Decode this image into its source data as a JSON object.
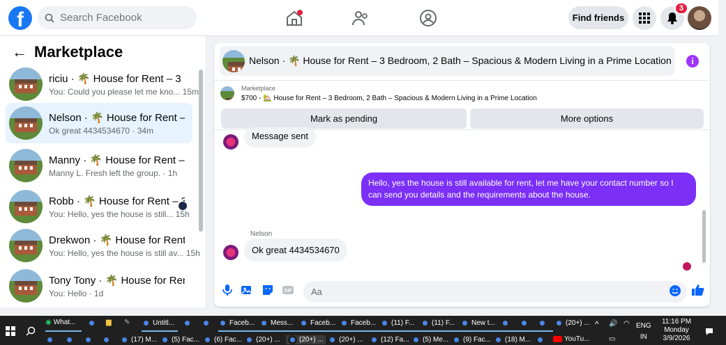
{
  "topbar": {
    "search_placeholder": "Search Facebook",
    "find_friends": "Find friends",
    "notif_count": "3"
  },
  "sidebar": {
    "title": "Marketplace",
    "conversations": [
      {
        "name": "riciu · 🌴 House for Rent – 3 Bed...",
        "sub": "You: Could you please let me kno... 15m"
      },
      {
        "name": "Nelson · 🌴 House for Rent – 3 ...",
        "sub": "Ok great 4434534670 · 34m"
      },
      {
        "name": "Manny · 🌴 House for Rent – 3 B...",
        "sub": "Manny L. Fresh left the group. · 1h"
      },
      {
        "name": "Robb · 🌴 House for Rent – 3 ...",
        "sub": "You: Hello, yes the house is still... 15h"
      },
      {
        "name": "Drekwon · 🌴 House for Rent – ...",
        "sub": "You: Hello, yes the house is still av... 15h"
      },
      {
        "name": "Tony Tony · 🌴 House for Rent – ...",
        "sub": "You: Hello · 1d"
      }
    ]
  },
  "chat": {
    "header_title": "Nelson · 🌴 House for Rent – 3 Bedroom, 2 Bath – Spacious & Modern Living in a Prime Location",
    "listing_label": "Marketplace",
    "listing_line": "$700 - 🏡 House for Rent – 3 Bedroom, 2 Bath – Spacious & Modern Living in a Prime Location",
    "mark_pending": "Mark as pending",
    "more_options": "More options",
    "msg_sent": "Message sent",
    "out_message": "Hello, yes the house is still available for rent, let me have your contact number so I can send you details and the requirements about the house.",
    "sender_name": "Nelson",
    "in_message": "Ok great 4434534670",
    "composer_placeholder": "Aa"
  },
  "taskbar": {
    "row1": [
      "What...",
      "",
      "",
      "",
      "Untitl...",
      "",
      "",
      "Faceb...",
      "Mess...",
      "Faceb...",
      "Faceb...",
      "(11) F...",
      "(11) F...",
      "New t...",
      "",
      "",
      "",
      "(20+) ..."
    ],
    "row2": [
      "",
      "",
      "",
      "",
      "(17) M...",
      "(5) Fac...",
      "(6) Fac...",
      "(20+) ...",
      "(20+) ...",
      "(20+) ...",
      "(12) Fa...",
      "(5) Me...",
      "(9) Fac...",
      "(18) M...",
      "",
      "YouTu..."
    ],
    "lang1": "ENG",
    "lang2": "IN",
    "time": "11:16 PM",
    "day": "Monday",
    "date": "3/9/2026"
  }
}
